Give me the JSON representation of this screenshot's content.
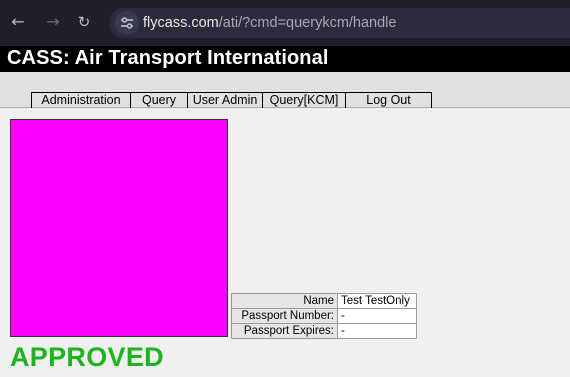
{
  "browser": {
    "url_host": "flycass.com",
    "url_path": "/ati/?cmd=querykcm/handle"
  },
  "header": {
    "title": "CASS: Air Transport International"
  },
  "menu": {
    "items": [
      {
        "label": "Administration"
      },
      {
        "label": "Query"
      },
      {
        "label": "User Admin"
      },
      {
        "label": "Query[KCM]"
      },
      {
        "label": "Log Out"
      }
    ]
  },
  "record": {
    "photo_color": "#ff00ff",
    "rows": [
      {
        "label": "Name",
        "value": "Test TestOnly"
      },
      {
        "label": "Passport Number:",
        "value": "-"
      },
      {
        "label": "Passport Expires:",
        "value": "-"
      }
    ]
  },
  "status": {
    "text": "APPROVED",
    "color": "#1db51d"
  }
}
